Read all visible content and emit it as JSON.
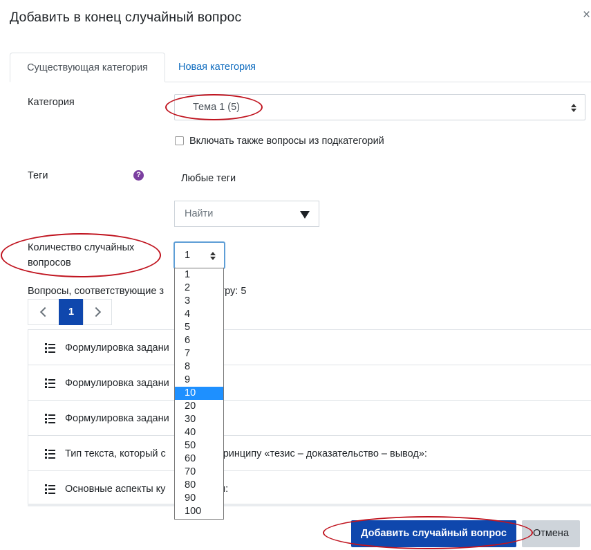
{
  "dialog": {
    "title": "Добавить в конец случайный вопрос",
    "close_glyph": "×"
  },
  "tabs": [
    {
      "label": "Существующая категория",
      "active": true
    },
    {
      "label": "Новая категория",
      "active": false
    }
  ],
  "category": {
    "label": "Категория",
    "value": "Тема 1 (5)"
  },
  "subcategories": {
    "label": "Включать также вопросы из подкатегорий",
    "checked": false
  },
  "tags": {
    "label": "Теги",
    "help_icon": "question-circle-icon",
    "help_glyph": "?",
    "value": "Любые теги",
    "search_placeholder": "Найти"
  },
  "count": {
    "label_line1": "Количество случайных",
    "label_line2": "вопросов",
    "value": "1",
    "options": [
      "1",
      "2",
      "3",
      "4",
      "5",
      "6",
      "7",
      "8",
      "9",
      "10",
      "20",
      "30",
      "40",
      "50",
      "60",
      "70",
      "80",
      "90",
      "100"
    ],
    "highlighted": "10"
  },
  "matches": {
    "prefix": "Вопросы, соответствующие з",
    "suffix": "ьтру: 5"
  },
  "pagination": {
    "current": "1"
  },
  "questions": [
    {
      "text": "Формулировка задани"
    },
    {
      "text": "Формулировка задани"
    },
    {
      "text": "Формулировка задани"
    },
    {
      "text_a": "Тип текста, который с",
      "text_b": "о принципу «тезис – доказательство – вывод»:"
    },
    {
      "text_a": "Основные аспекты ку",
      "text_b": "чи:"
    }
  ],
  "buttons": {
    "add": "Добавить случайный вопрос",
    "cancel": "Отмена"
  },
  "annotation_color": "#c0141f"
}
